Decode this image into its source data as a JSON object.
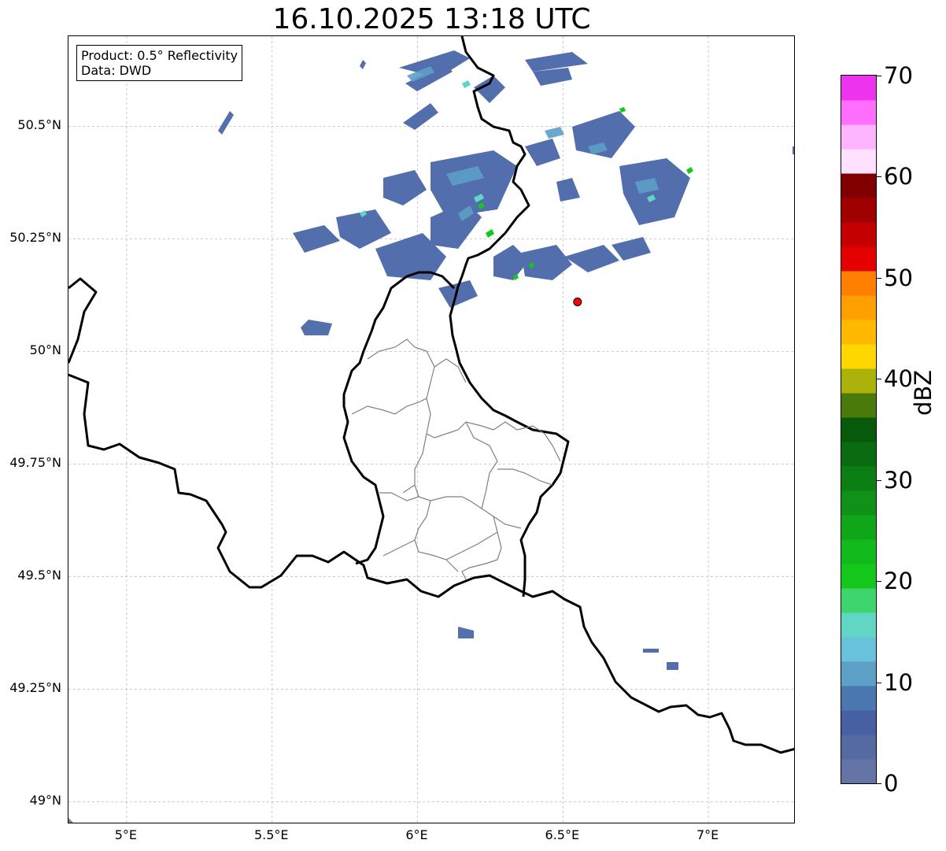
{
  "title": "16.10.2025 13:18 UTC",
  "info_box": {
    "product": "Product: 0.5° Reflectivity",
    "data": "Data: DWD"
  },
  "map_extent": {
    "lon_min": 4.8,
    "lon_max": 7.3,
    "lat_min": 48.95,
    "lat_max": 50.7
  },
  "lat_ticks": [
    {
      "value": 50.5,
      "label": "50.5°N"
    },
    {
      "value": 50.25,
      "label": "50.25°N"
    },
    {
      "value": 50.0,
      "label": "50°N"
    },
    {
      "value": 49.75,
      "label": "49.75°N"
    },
    {
      "value": 49.5,
      "label": "49.5°N"
    },
    {
      "value": 49.25,
      "label": "49.25°N"
    },
    {
      "value": 49.0,
      "label": "49°N"
    }
  ],
  "lon_ticks": [
    {
      "value": 5.0,
      "label": "5°E"
    },
    {
      "value": 5.5,
      "label": "5.5°E"
    },
    {
      "value": 6.0,
      "label": "6°E"
    },
    {
      "value": 6.5,
      "label": "6.5°E"
    },
    {
      "value": 7.0,
      "label": "7°E"
    }
  ],
  "marker": {
    "lon": 6.55,
    "lat": 50.11,
    "color": "#ff0000"
  },
  "colorbar": {
    "label": "dBZ",
    "min": 0,
    "max": 70,
    "ticks": [
      {
        "value": 0,
        "label": "0"
      },
      {
        "value": 10,
        "label": "10"
      },
      {
        "value": 20,
        "label": "20"
      },
      {
        "value": 30,
        "label": "30"
      },
      {
        "value": 40,
        "label": "40"
      },
      {
        "value": 50,
        "label": "50"
      },
      {
        "value": 60,
        "label": "60"
      },
      {
        "value": 70,
        "label": "70"
      }
    ],
    "colors": [
      "#6574a6",
      "#5569a2",
      "#4660a3",
      "#4b77b0",
      "#5c9fc7",
      "#68c2dc",
      "#62d6c4",
      "#3ed46e",
      "#14c81b",
      "#12ba1c",
      "#10a61a",
      "#0f9217",
      "#0c7f14",
      "#0a6c11",
      "#075a0c",
      "#497a0a",
      "#adb20a",
      "#ffd700",
      "#ffba00",
      "#ffa000",
      "#ff7f00",
      "#e50000",
      "#c40000",
      "#a00000",
      "#800000",
      "#ffe0ff",
      "#ffb4ff",
      "#ff6eff",
      "#ee33ee"
    ]
  },
  "colors": {
    "border": "#000000",
    "district": "#808080",
    "grid": "#bbbbbb",
    "echo_light": "#4a67a8",
    "echo_mid": "#5c9fc7",
    "echo_teal": "#62d6c4",
    "echo_green": "#14c81b"
  }
}
